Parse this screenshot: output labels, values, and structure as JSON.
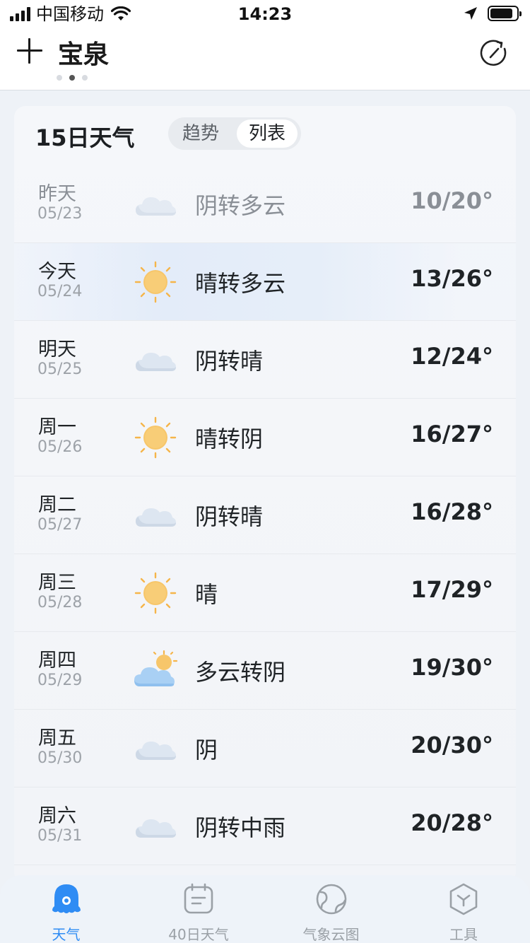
{
  "status_bar": {
    "carrier": "中国移动",
    "time": "14:23",
    "battery_level": 0.85
  },
  "header": {
    "city": "宝泉",
    "page_count": 3,
    "active_page": 1
  },
  "forecast": {
    "title": "15日天气",
    "toggle": [
      {
        "label": "趋势",
        "active": false
      },
      {
        "label": "列表",
        "active": true
      }
    ],
    "days": [
      {
        "day": "昨天",
        "date": "05/23",
        "weather": "阴转多云",
        "temp": "10/20°",
        "icon": "overcast-icon",
        "state": "past"
      },
      {
        "day": "今天",
        "date": "05/24",
        "weather": "晴转多云",
        "temp": "13/26°",
        "icon": "sunny-icon",
        "state": "today"
      },
      {
        "day": "明天",
        "date": "05/25",
        "weather": "阴转晴",
        "temp": "12/24°",
        "icon": "overcast-icon",
        "state": "future"
      },
      {
        "day": "周一",
        "date": "05/26",
        "weather": "晴转阴",
        "temp": "16/27°",
        "icon": "sunny-icon",
        "state": "future"
      },
      {
        "day": "周二",
        "date": "05/27",
        "weather": "阴转晴",
        "temp": "16/28°",
        "icon": "overcast-icon",
        "state": "future"
      },
      {
        "day": "周三",
        "date": "05/28",
        "weather": "晴",
        "temp": "17/29°",
        "icon": "sunny-icon",
        "state": "future"
      },
      {
        "day": "周四",
        "date": "05/29",
        "weather": "多云转阴",
        "temp": "19/30°",
        "icon": "partly-cloudy-icon",
        "state": "future"
      },
      {
        "day": "周五",
        "date": "05/30",
        "weather": "阴",
        "temp": "20/30°",
        "icon": "overcast-icon",
        "state": "future"
      },
      {
        "day": "周六",
        "date": "05/31",
        "weather": "阴转中雨",
        "temp": "20/28°",
        "icon": "overcast-icon",
        "state": "future"
      }
    ]
  },
  "tabbar": {
    "tabs": [
      {
        "label": "天气",
        "icon": "weather-tab-icon",
        "active": true
      },
      {
        "label": "40日天气",
        "icon": "calendar-tab-icon",
        "active": false
      },
      {
        "label": "气象云图",
        "icon": "globe-tab-icon",
        "active": false
      },
      {
        "label": "工具",
        "icon": "tools-tab-icon",
        "active": false
      }
    ]
  },
  "colors": {
    "accent": "#2f8cf4",
    "sun": "#f5b54a",
    "cloud": "#dfe7f1"
  }
}
